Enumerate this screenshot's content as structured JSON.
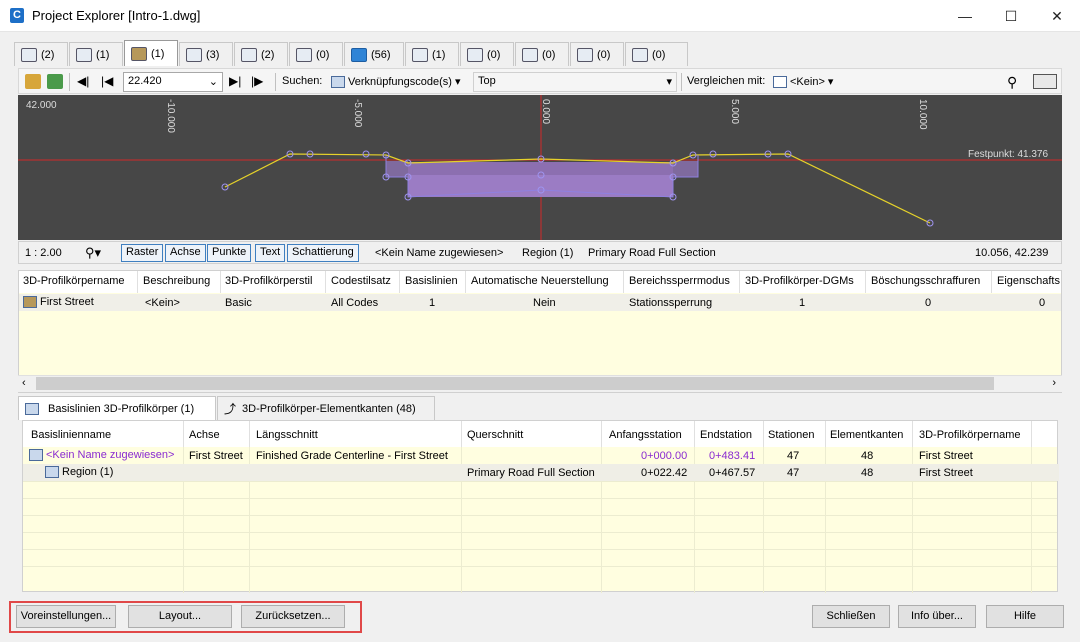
{
  "window": {
    "title": "Project Explorer [Intro-1.dwg]",
    "app_icon_letter": "C"
  },
  "tabs": [
    {
      "icon": "alignment-icon",
      "count": "(2)"
    },
    {
      "icon": "profile-icon",
      "count": "(1)"
    },
    {
      "icon": "corridor-icon",
      "count": "(1)"
    },
    {
      "icon": "assembly-icon",
      "count": "(3)"
    },
    {
      "icon": "surface-icon",
      "count": "(2)"
    },
    {
      "icon": "featureline-icon",
      "count": "(0)"
    },
    {
      "icon": "pipe-icon",
      "count": "(56)"
    },
    {
      "icon": "structure-icon",
      "count": "(1)"
    },
    {
      "icon": "pressure-icon",
      "count": "(0)"
    },
    {
      "icon": "sampleline-icon",
      "count": "(0)"
    },
    {
      "icon": "point-icon",
      "count": "(0)"
    },
    {
      "icon": "parcel-icon",
      "count": "(0)"
    }
  ],
  "toolbar": {
    "station": "22.420",
    "search_label": "Suchen:",
    "search_field": "Verknüpfungscode(s)",
    "search_value": "Top",
    "compare_label": "Vergleichen mit:",
    "compare_value": "<Kein>"
  },
  "view": {
    "elevation_label": "42.000",
    "x_ticks": [
      "-10.000",
      "-5.000",
      "0.000",
      "5.000",
      "10.000"
    ],
    "fixpoint_label": "Festpunkt: 41.376"
  },
  "statusbar": {
    "scale": "1 : 2.00",
    "toggles": [
      "Raster",
      "Achse",
      "Punkte",
      "Text",
      "Schattierung"
    ],
    "baseline": "<Kein Name zugewiesen>",
    "region": "Region (1)",
    "assembly": "Primary Road Full Section",
    "coordinates": "10.056, 42.239"
  },
  "grid1": {
    "columns": [
      "3D-Profilkörpername",
      "Beschreibung",
      "3D-Profilkörperstil",
      "Codestilsatz",
      "Basislinien",
      "Automatische Neuerstellung",
      "Bereichssperrmodus",
      "3D-Profilkörper-DGMs",
      "Böschungsschraffuren",
      "Eigenschafts"
    ],
    "rows": [
      [
        "First Street",
        "<Kein>",
        "Basic",
        "All Codes",
        "1",
        "Nein",
        "Stationssperrung",
        "1",
        "0",
        "0"
      ]
    ]
  },
  "lower_tabs": [
    {
      "label": "Basislinien 3D-Profilkörper (1)"
    },
    {
      "label": "3D-Profilkörper-Elementkanten (48)"
    }
  ],
  "grid2": {
    "columns": [
      "Basislinienname",
      "Achse",
      "Längsschnitt",
      "Querschnitt",
      "Anfangsstation",
      "Endstation",
      "Stationen",
      "Elementkanten",
      "3D-Profilkörpername"
    ],
    "rows": [
      {
        "name": "<Kein Name zugewiesen>",
        "achse": "First Street",
        "laengs": "Finished Grade Centerline - First Street",
        "quer": "",
        "start": "0+000.00",
        "end": "0+483.41",
        "stations": "47",
        "edges": "48",
        "corridor": "First Street"
      },
      {
        "name": "Region (1)",
        "achse": "",
        "laengs": "",
        "quer": "Primary Road Full Section",
        "start": "0+022.42",
        "end": "0+467.57",
        "stations": "47",
        "edges": "48",
        "corridor": "First Street"
      }
    ]
  },
  "buttons": {
    "settings": "Voreinstellungen...",
    "layout": "Layout...",
    "reset": "Zurücksetzen...",
    "close": "Schließen",
    "about": "Info über...",
    "help": "Hilfe"
  }
}
